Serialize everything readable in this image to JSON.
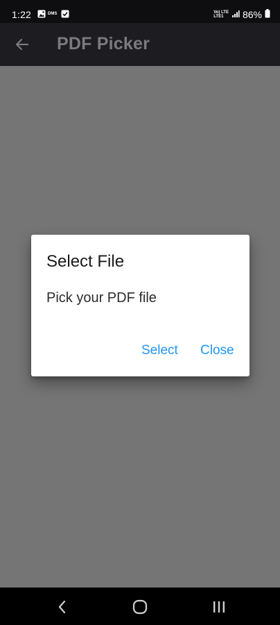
{
  "status_bar": {
    "time": "1:22",
    "notification_icons": [
      "gallery-icon",
      "dms-icon",
      "check-box-icon"
    ],
    "network_label_top": "Vo) LTE",
    "network_label_bottom": "LTE1",
    "battery": "86%"
  },
  "app_bar": {
    "title": "PDF Picker",
    "back_icon": "arrow-left-icon"
  },
  "dialog": {
    "title": "Select File",
    "message": "Pick your PDF file",
    "actions": {
      "select_label": "Select",
      "close_label": "Close"
    }
  },
  "nav_bar": {
    "buttons": [
      "back-icon",
      "home-icon",
      "recent-apps-icon"
    ]
  },
  "colors": {
    "scrim": "#757575",
    "app_bar_bg": "#1d1d21",
    "accent": "#2196f3",
    "dialog_bg": "#ffffff"
  }
}
